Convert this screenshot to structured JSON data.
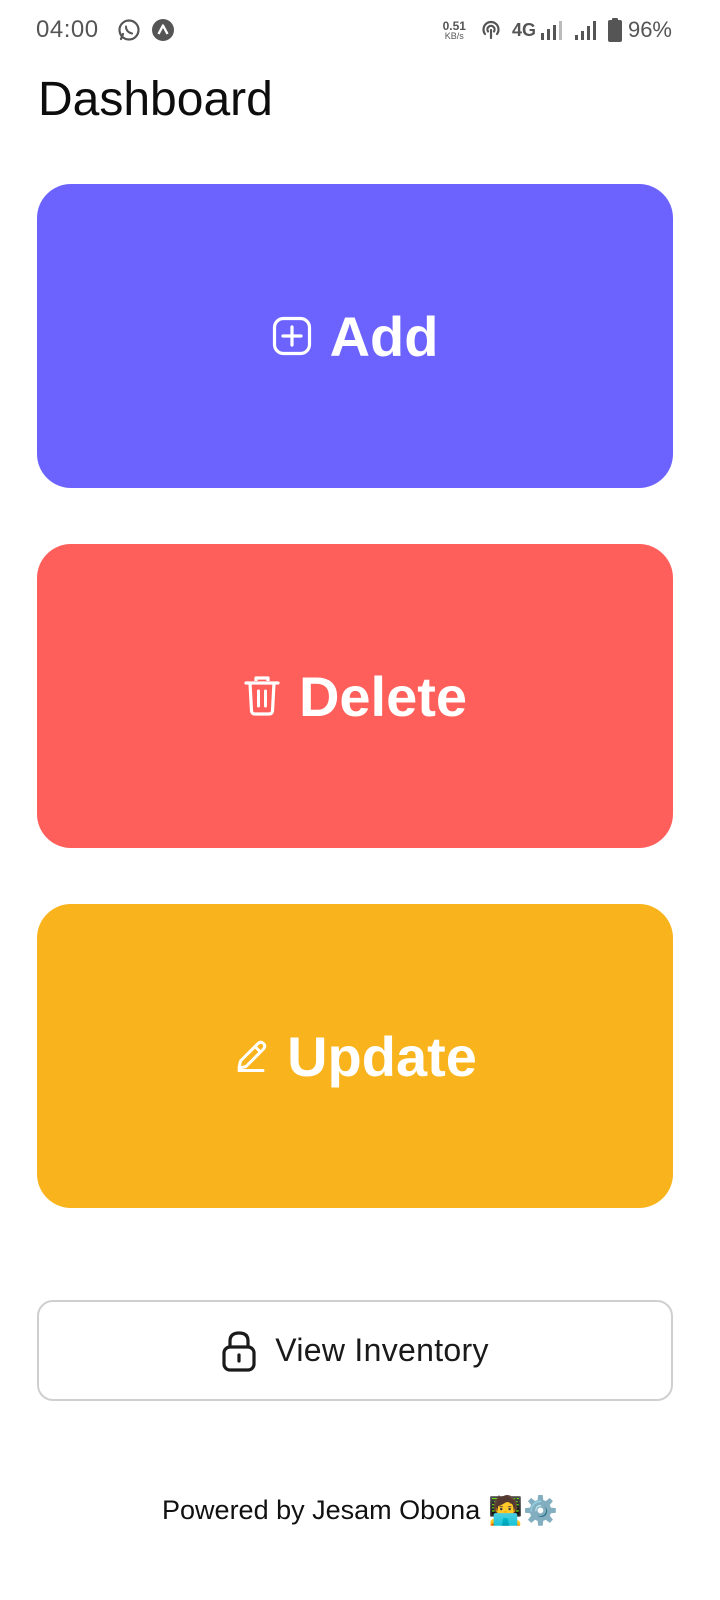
{
  "status_bar": {
    "time": "04:00",
    "net_speed_value": "0.51",
    "net_speed_unit": "KB/s",
    "network_type": "4G",
    "battery_percent": "96%",
    "left_icons": [
      "whatsapp-icon",
      "app-notification-icon"
    ],
    "right_icons": [
      "hotspot-icon",
      "signal-bars-icon",
      "signal-bars-icon",
      "battery-icon"
    ]
  },
  "header": {
    "title": "Dashboard"
  },
  "actions": {
    "add": {
      "label": "Add",
      "icon": "add-square-icon",
      "color": "#6c63ff"
    },
    "delete": {
      "label": "Delete",
      "icon": "trash-icon",
      "color": "#ff5f5b"
    },
    "update": {
      "label": "Update",
      "icon": "pencil-icon",
      "color": "#f9b31c"
    }
  },
  "inventory": {
    "label": "View Inventory",
    "icon": "lock-icon"
  },
  "footer": {
    "text": "Powered by Jesam Obona",
    "emoji": "🧑‍💻⚙️"
  }
}
